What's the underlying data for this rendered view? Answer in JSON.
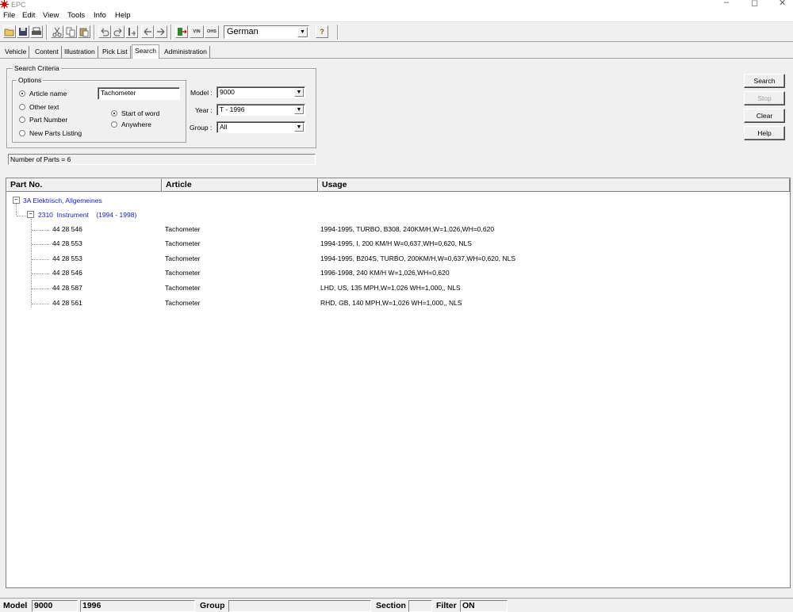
{
  "app": {
    "title": "EPC",
    "logo_icon": "epc-logo-icon",
    "accent": "#cc0000"
  },
  "window_controls": {
    "minimize": "–",
    "restore": "◻",
    "close": "✕"
  },
  "menu": [
    "File",
    "Edit",
    "View",
    "Tools",
    "Info",
    "Help"
  ],
  "toolbar": {
    "icons": [
      "open-folder-icon",
      "save-icon",
      "print-icon",
      "cut-icon",
      "copy-icon",
      "paste-icon",
      "undo-icon",
      "redo-icon",
      "bookmark-icon",
      "back-arrow-icon",
      "forward-arrow-icon",
      "exit-icon",
      "vin-icon",
      "ohs-icon",
      "help-question-icon"
    ],
    "vin_label": "VIN",
    "ohs_label": "OHS",
    "language": "German"
  },
  "tabs": [
    "Vehicle",
    "Content",
    "Illustration",
    "Pick List",
    "Search",
    "Administration"
  ],
  "active_tab": "Search",
  "search": {
    "criteria_label": "Search Criteria",
    "options_label": "Options",
    "article_name": "Article name",
    "other_text": "Other text",
    "part_number": "Part Number",
    "new_parts": "New Parts Listing",
    "article_value": "Tachometer",
    "start_of_word": "Start of word",
    "anywhere": "Anywhere",
    "model_label": "Model :",
    "model_value": "9000",
    "year_label": "Year :",
    "year_value": "T - 1996",
    "group_label": "Group :",
    "group_value": "All",
    "buttons": {
      "search": "Search",
      "stop": "Stop",
      "clear": "Clear",
      "help": "Help"
    },
    "parts_count": "Number of Parts = 6"
  },
  "results": {
    "columns": [
      "Part No.",
      "Article",
      "Usage"
    ],
    "group": {
      "code": "3A",
      "name": "Elektrisch, Allgemeines"
    },
    "subgroup": {
      "code": "2310",
      "name": "Instrument",
      "years": "(1994 - 1998)"
    },
    "rows": [
      {
        "part": "44 28 546",
        "article": "Tachometer",
        "usage": "1994-1995, TURBO, B308,  240KM/H,W=1,026,WH=0,620"
      },
      {
        "part": "44 28 553",
        "article": "Tachometer",
        "usage": "1994-1995, I, 200 KM/H W=0,637,WH=0,620, NLS"
      },
      {
        "part": "44 28 553",
        "article": "Tachometer",
        "usage": "1994-1995, B204S, TURBO,  200KM/H,W=0,637,WH=0,620, NLS"
      },
      {
        "part": "44 28 546",
        "article": "Tachometer",
        "usage": "1996-1998, 240 KM/H W=1,026,WH=0,620"
      },
      {
        "part": "44 28 587",
        "article": "Tachometer",
        "usage": "LHD, US, 135 MPH,W=1,026 WH=1,000,, NLS"
      },
      {
        "part": "44 28 561",
        "article": "Tachometer",
        "usage": "RHD, GB, 140 MPH,W=1,026 WH=1,000,, NLS"
      }
    ]
  },
  "status": {
    "model_label": "Model",
    "model_value": "9000",
    "year_value": "1996",
    "group_label": "Group",
    "group_value": "",
    "section_label": "Section",
    "section_value": "",
    "filter_label": "Filter",
    "filter_value": "ON"
  }
}
